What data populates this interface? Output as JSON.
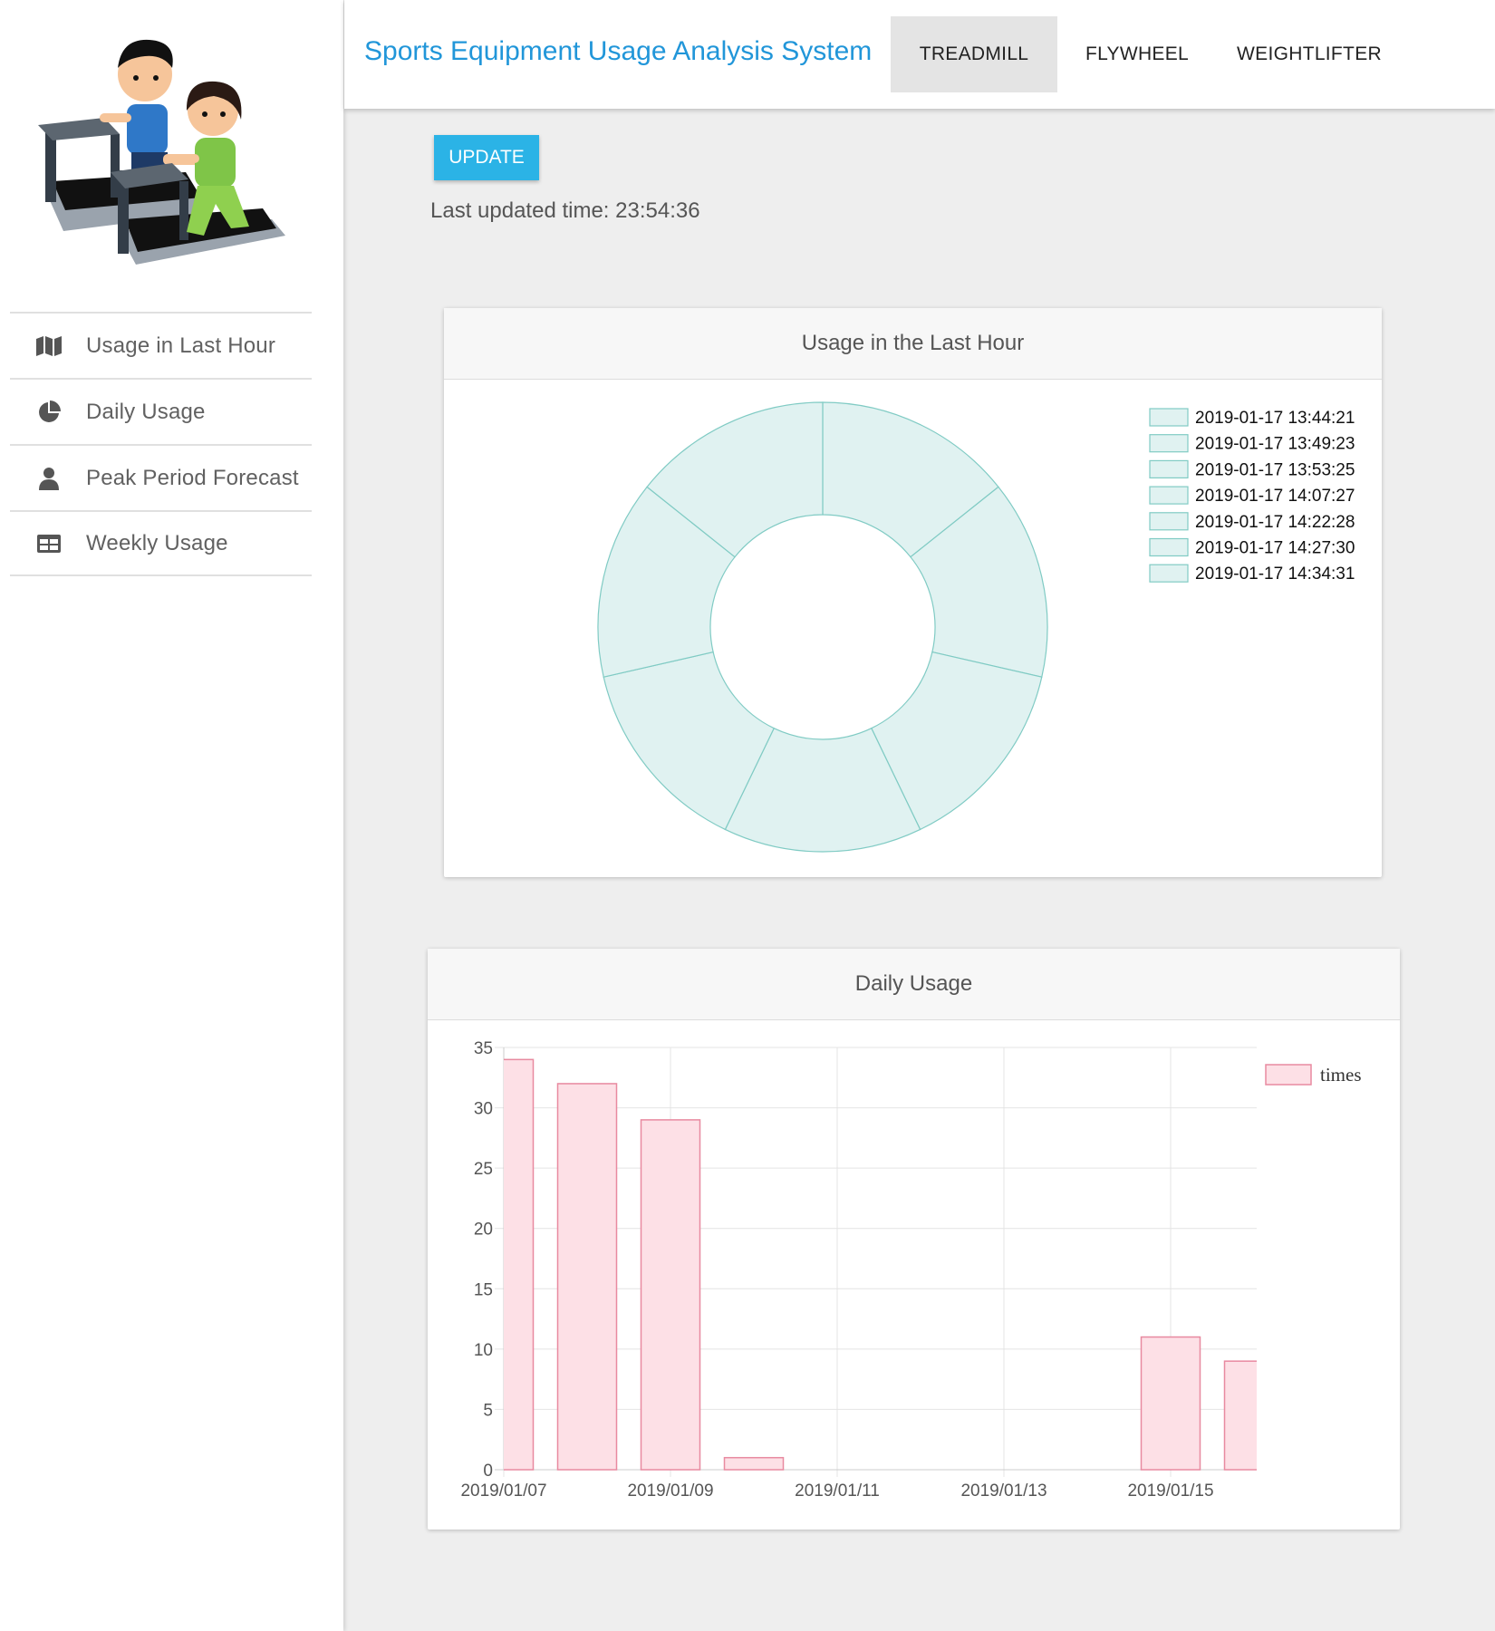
{
  "sidebar": {
    "items": [
      {
        "label": "Usage in Last Hour",
        "icon": "map-icon"
      },
      {
        "label": "Daily Usage",
        "icon": "pie-chart-icon"
      },
      {
        "label": "Peak Period Forecast",
        "icon": "user-icon"
      },
      {
        "label": "Weekly Usage",
        "icon": "table-icon"
      }
    ]
  },
  "header": {
    "title": "Sports Equipment Usage Analysis System",
    "tabs": [
      {
        "label": "TREADMILL",
        "active": true
      },
      {
        "label": "FLYWHEEL",
        "active": false
      },
      {
        "label": "WEIGHTLIFTER",
        "active": false
      }
    ]
  },
  "controls": {
    "update_label": "UPDATE",
    "last_updated": "Last updated time: 23:54:36"
  },
  "colors": {
    "accent": "#2196d9",
    "button": "#2bb3e6",
    "doughnut_fill": "#e0f2f1",
    "doughnut_stroke": "#80cbc4",
    "bar_fill": "#fde0e6",
    "bar_stroke": "#e88aa0"
  },
  "chart_data": [
    {
      "type": "doughnut",
      "title": "Usage in the Last Hour",
      "labels": [
        "2019-01-17 13:44:21",
        "2019-01-17 13:49:23",
        "2019-01-17 13:53:25",
        "2019-01-17 14:07:27",
        "2019-01-17 14:22:28",
        "2019-01-17 14:27:30",
        "2019-01-17 14:34:31"
      ],
      "values": [
        1,
        1,
        1,
        1,
        1,
        1,
        1
      ],
      "legend": "right"
    },
    {
      "type": "bar",
      "title": "Daily Usage",
      "x": [
        "2019/01/07",
        "2019/01/08",
        "2019/01/09",
        "2019/01/10",
        "2019/01/11",
        "2019/01/12",
        "2019/01/13",
        "2019/01/14",
        "2019/01/15",
        "2019/01/16"
      ],
      "xticks": [
        "2019/01/07",
        "2019/01/09",
        "2019/01/11",
        "2019/01/13",
        "2019/01/15"
      ],
      "series": [
        {
          "name": "times",
          "values": [
            34,
            32,
            29,
            1,
            0,
            0,
            0,
            0,
            11,
            9
          ]
        }
      ],
      "ylim": [
        0,
        35
      ],
      "yticks": [
        0,
        5,
        10,
        15,
        20,
        25,
        30,
        35
      ],
      "grid": true,
      "legend": "top-right"
    }
  ]
}
